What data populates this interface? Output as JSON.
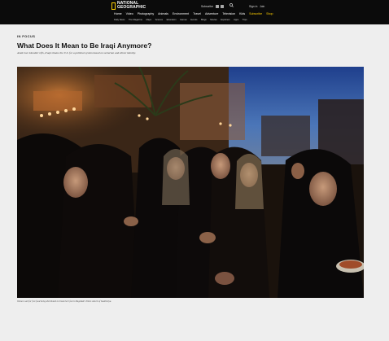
{
  "header": {
    "logo_lines": [
      "NATIONAL",
      "GEOGRAPHIC"
    ],
    "subscribe_label": "Subscribe",
    "sign_in": "Sign in",
    "join": "Join",
    "nav": [
      {
        "label": "Home",
        "accent": false
      },
      {
        "label": "Video",
        "accent": false
      },
      {
        "label": "Photography",
        "accent": false
      },
      {
        "label": "Animals",
        "accent": false
      },
      {
        "label": "Environment",
        "accent": false
      },
      {
        "label": "Travel",
        "accent": false
      },
      {
        "label": "Adventure",
        "accent": false
      },
      {
        "label": "Television",
        "accent": false
      },
      {
        "label": "Kids",
        "accent": false
      },
      {
        "label": "Subscribe",
        "accent": true
      },
      {
        "label": "Shop",
        "accent": true
      }
    ],
    "subnav": [
      "Daily News",
      "The Magazine",
      "Maps",
      "Science",
      "Education",
      "Games",
      "Events",
      "Blogs",
      "Movies",
      "Explorers",
      "Apps",
      "Trips"
    ],
    "accent_color": "#ffce00"
  },
  "article": {
    "kicker": "IN FOCUS",
    "headline": "What Does It Mean to Be Iraqi Anymore?",
    "dek": "Amid ever-bloodier rifts, Iraqis blame the U.S. for a political system based on sectarian and ethnic identity.",
    "caption": "Women wait for free food being distributed to break their fast in Baghdad's Shiite suburb of Kadhimiya."
  }
}
